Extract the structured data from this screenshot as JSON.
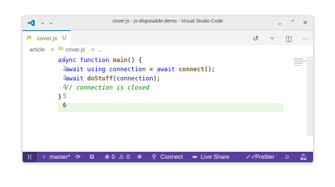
{
  "window": {
    "title": "cover.js - js-disposable-demo - Visual Studio Code"
  },
  "tab": {
    "icon": "JS",
    "name": "cover.js",
    "status": "U"
  },
  "breadcrumb": {
    "folder": "article",
    "sep1": ">",
    "file_icon": "JS",
    "file": "cover.js",
    "sep2": ">",
    "more": "..."
  },
  "editor": {
    "line_numbers": [
      "1",
      "2",
      "3",
      "4",
      "5",
      "6"
    ],
    "active_line": "6"
  },
  "code": {
    "l1": {
      "async": "async",
      "function": "function",
      "name": "main",
      "rest": "() {"
    },
    "l2": {
      "ws": "··",
      "await1": "await",
      "using": "using",
      "var": "connection",
      "eq": "=",
      "await2": "await",
      "call": "connect",
      "rest": "();"
    },
    "l3": {
      "ws": "··",
      "await": "await",
      "call": "doStuff",
      "open": "(",
      "arg": "connection",
      "rest": ");"
    },
    "l4": {
      "ws": "··",
      "comment": "// connection is closed"
    },
    "l5": {
      "brace": "}"
    }
  },
  "statusbar": {
    "branch": "master*",
    "errors": "0",
    "warnings": "0",
    "connect": "Connect",
    "liveshare": "Live Share",
    "prettier": "Prettier"
  },
  "colors": {
    "accent": "#0066b8",
    "statusbar": "#583f9c",
    "remote": "#40306f",
    "current_line": "#eaf7e0"
  },
  "icons": [
    "vscode-logo-icon",
    "split-editor-icon",
    "history-icon",
    "source-control-icon",
    "more-icon",
    "remote-icon",
    "branch-icon",
    "sync-icon",
    "extensions-icon",
    "error-icon",
    "warning-icon",
    "ports-icon",
    "connect-icon",
    "live-share-icon",
    "prettier-icon",
    "feedback-icon",
    "bell-icon"
  ]
}
